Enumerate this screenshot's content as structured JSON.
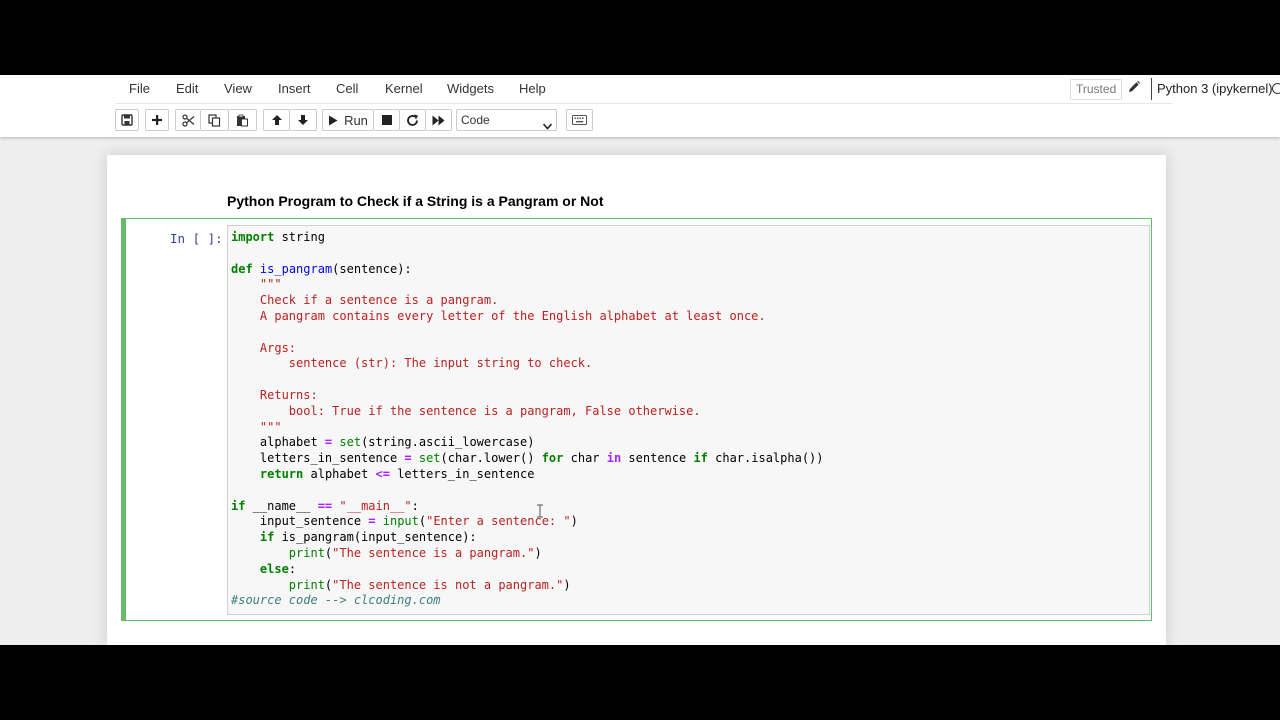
{
  "menu": {
    "items": [
      "File",
      "Edit",
      "View",
      "Insert",
      "Cell",
      "Kernel",
      "Widgets",
      "Help"
    ]
  },
  "status": {
    "trusted": "Trusted",
    "kernel": "Python 3 (ipykernel)"
  },
  "toolbar": {
    "run_label": "Run",
    "cell_type": "Code",
    "icons": [
      "save-icon",
      "plus-icon",
      "scissors-icon",
      "copy-icon",
      "paste-icon",
      "arrow-up-icon",
      "arrow-down-icon",
      "play-icon",
      "stop-icon",
      "restart-icon",
      "fast-forward-icon",
      "keyboard-icon"
    ]
  },
  "notebook": {
    "heading": "Python Program to Check if a String is a Pangram or Not",
    "cell_prompt": "In [ ]:",
    "code_lines": [
      [
        [
          "kw",
          "import"
        ],
        [
          "name",
          " string"
        ]
      ],
      [],
      [
        [
          "kw",
          "def"
        ],
        [
          "name",
          " "
        ],
        [
          "def",
          "is_pangram"
        ],
        [
          "name",
          "(sentence):"
        ]
      ],
      [
        [
          "name",
          "    "
        ],
        [
          "str",
          "\"\"\""
        ]
      ],
      [
        [
          "str",
          "    Check if a sentence is a pangram."
        ]
      ],
      [
        [
          "str",
          "    A pangram contains every letter of the English alphabet at least once."
        ]
      ],
      [],
      [
        [
          "str",
          "    Args:"
        ]
      ],
      [
        [
          "str",
          "        sentence (str): The input string to check."
        ]
      ],
      [],
      [
        [
          "str",
          "    Returns:"
        ]
      ],
      [
        [
          "str",
          "        bool: True if the sentence is a pangram, False otherwise."
        ]
      ],
      [
        [
          "str",
          "    \"\"\""
        ]
      ],
      [
        [
          "name",
          "    alphabet "
        ],
        [
          "op",
          "="
        ],
        [
          "name",
          " "
        ],
        [
          "builtin",
          "set"
        ],
        [
          "name",
          "(string.ascii_lowercase)"
        ]
      ],
      [
        [
          "name",
          "    letters_in_sentence "
        ],
        [
          "op",
          "="
        ],
        [
          "name",
          " "
        ],
        [
          "builtin",
          "set"
        ],
        [
          "name",
          "(char.lower() "
        ],
        [
          "kw",
          "for"
        ],
        [
          "name",
          " char "
        ],
        [
          "op",
          "in"
        ],
        [
          "name",
          " sentence "
        ],
        [
          "kw",
          "if"
        ],
        [
          "name",
          " char.isalpha())"
        ]
      ],
      [
        [
          "name",
          "    "
        ],
        [
          "kw",
          "return"
        ],
        [
          "name",
          " alphabet "
        ],
        [
          "op",
          "<="
        ],
        [
          "name",
          " letters_in_sentence"
        ]
      ],
      [],
      [
        [
          "kw",
          "if"
        ],
        [
          "name",
          " __name__ "
        ],
        [
          "op",
          "=="
        ],
        [
          "name",
          " "
        ],
        [
          "str",
          "\"__main__\""
        ],
        [
          "name",
          ":"
        ]
      ],
      [
        [
          "name",
          "    input_sentence "
        ],
        [
          "op",
          "="
        ],
        [
          "name",
          " "
        ],
        [
          "builtin",
          "input"
        ],
        [
          "name",
          "("
        ],
        [
          "str",
          "\"Enter a sentence: \""
        ],
        [
          "name",
          ")"
        ]
      ],
      [
        [
          "name",
          "    "
        ],
        [
          "kw",
          "if"
        ],
        [
          "name",
          " is_pangram(input_sentence):"
        ]
      ],
      [
        [
          "name",
          "        "
        ],
        [
          "builtin",
          "print"
        ],
        [
          "name",
          "("
        ],
        [
          "str",
          "\"The sentence is a pangram.\""
        ],
        [
          "name",
          ")"
        ]
      ],
      [
        [
          "name",
          "    "
        ],
        [
          "kw",
          "else"
        ],
        [
          "name",
          ":"
        ]
      ],
      [
        [
          "name",
          "        "
        ],
        [
          "builtin",
          "print"
        ],
        [
          "name",
          "("
        ],
        [
          "str",
          "\"The sentence is not a pangram.\""
        ],
        [
          "name",
          ")"
        ]
      ],
      [
        [
          "comment",
          "#source code --> clcoding.com"
        ]
      ]
    ]
  },
  "colors": {
    "cell_border": "#66bb6a",
    "prompt": "#303f9f",
    "keyword": "#008000",
    "string": "#ba2121",
    "function_def": "#0000ff",
    "operator": "#aa22ff",
    "comment": "#408080"
  }
}
